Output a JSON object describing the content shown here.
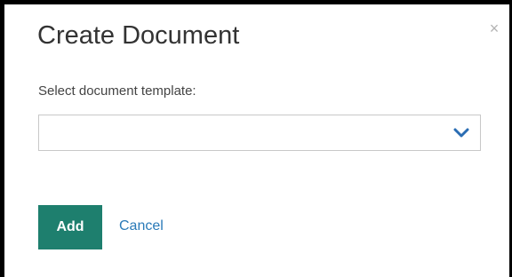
{
  "dialog": {
    "title": "Create Document",
    "close_glyph": "×",
    "field_label": "Select document template:",
    "template_select": {
      "selected_value": "",
      "icon": "chevron-down-icon"
    },
    "add_label": "Add",
    "cancel_label": "Cancel"
  },
  "colors": {
    "primary_button": "#1e7f6e",
    "link": "#2a7ab8",
    "chevron": "#2a6db3"
  }
}
